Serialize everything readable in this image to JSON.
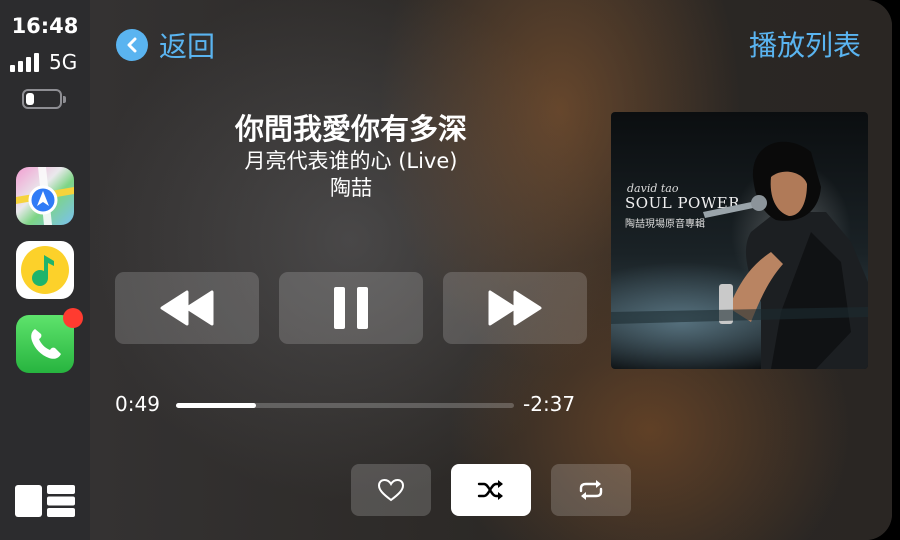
{
  "status": {
    "time": "16:48",
    "network": "5G",
    "battery_level": 0.25
  },
  "sidebar": {
    "apps": [
      {
        "name": "maps-app-icon"
      },
      {
        "name": "music-app-icon"
      },
      {
        "name": "phone-app-icon",
        "badge": true
      }
    ]
  },
  "header": {
    "back_label": "返回",
    "playlist_label": "播放列表"
  },
  "now_playing": {
    "title": "你問我愛你有多深",
    "album": "月亮代表谁的心 (Live)",
    "artist": "陶喆",
    "elapsed": "0:49",
    "remaining": "-2:37",
    "progress": 0.236
  },
  "cover": {
    "artist_text": "david tao",
    "title_text": "SOUL POWER",
    "subtitle_text": "陶喆現場原音專輯"
  },
  "controls": {
    "rewind_icon": "rewind-icon",
    "pause_icon": "pause-icon",
    "forward_icon": "fast-forward-icon"
  },
  "bottom_buttons": {
    "favorite_icon": "heart-icon",
    "shuffle_icon": "shuffle-icon",
    "shuffle_active": true,
    "repeat_icon": "repeat-icon"
  },
  "colors": {
    "accent": "#5ab4f0",
    "badge": "#ff3b30"
  }
}
